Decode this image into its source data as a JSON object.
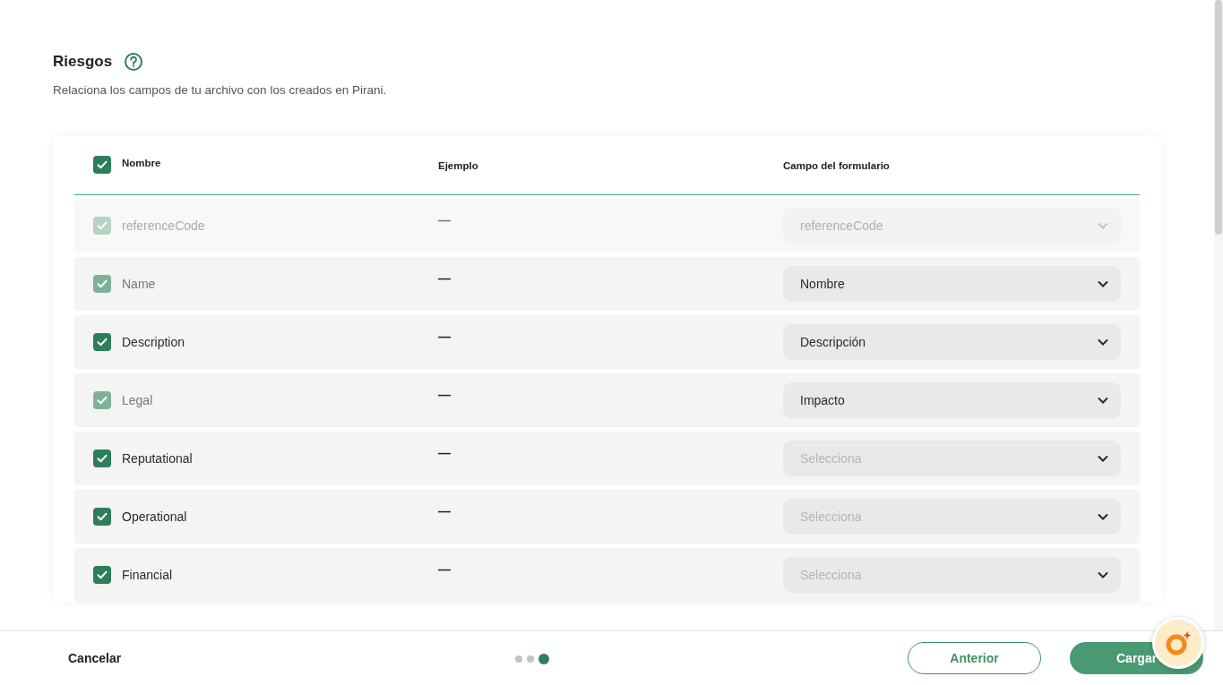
{
  "section": {
    "title": "Riesgos",
    "subtitle": "Relaciona los campos de tu archivo con los creados en Pirani."
  },
  "table": {
    "select_all_checked": true,
    "columns": [
      "Nombre",
      "Ejemplo",
      "Campo del formulario"
    ],
    "rows": [
      {
        "name": "referenceCode",
        "example": "—",
        "checked": true,
        "locked": false,
        "disabled": true,
        "field": {
          "value": "referenceCode"
        }
      },
      {
        "name": "Name",
        "example": "—",
        "checked": true,
        "locked": true,
        "disabled": false,
        "field": {
          "value": "Nombre"
        }
      },
      {
        "name": "Description",
        "example": "—",
        "checked": true,
        "locked": false,
        "disabled": false,
        "field": {
          "value": "Descripción"
        }
      },
      {
        "name": "Legal",
        "example": "—",
        "checked": true,
        "locked": true,
        "disabled": false,
        "field": {
          "value": "Impacto"
        }
      },
      {
        "name": "Reputational",
        "example": "—",
        "checked": true,
        "locked": false,
        "disabled": false,
        "field": {
          "placeholder": "Selecciona"
        }
      },
      {
        "name": "Operational",
        "example": "—",
        "checked": true,
        "locked": false,
        "disabled": false,
        "field": {
          "placeholder": "Selecciona"
        }
      },
      {
        "name": "Financial",
        "example": "—",
        "checked": true,
        "locked": false,
        "disabled": false,
        "field": {
          "placeholder": "Selecciona"
        }
      }
    ]
  },
  "footer": {
    "cancel": "Cancelar",
    "steps": [
      {
        "selected": false
      },
      {
        "selected": false
      },
      {
        "selected": true
      }
    ],
    "back": "Anterior",
    "next": "Cargar"
  }
}
